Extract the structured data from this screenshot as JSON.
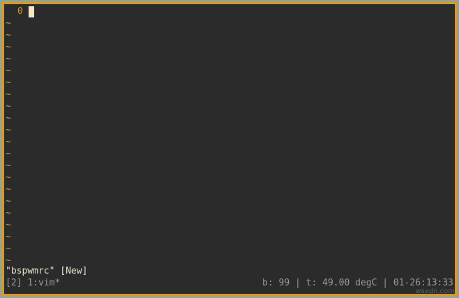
{
  "editor": {
    "line_number": "0",
    "empty_line_marker": "~",
    "empty_line_count": 21
  },
  "message": "\"bspwmrc\" [New]",
  "status": {
    "session": "[2]",
    "window": "1:vim*",
    "battery": "b: 99",
    "temperature": "t: 49.00 degC",
    "clock": "01-26:13:33",
    "separator": "|"
  },
  "watermark": "wsxdn.com",
  "colors": {
    "border": "#d39a2c",
    "background": "#2b2b2b",
    "line_number": "#d39a2c",
    "cursor": "#f3e7c4"
  }
}
